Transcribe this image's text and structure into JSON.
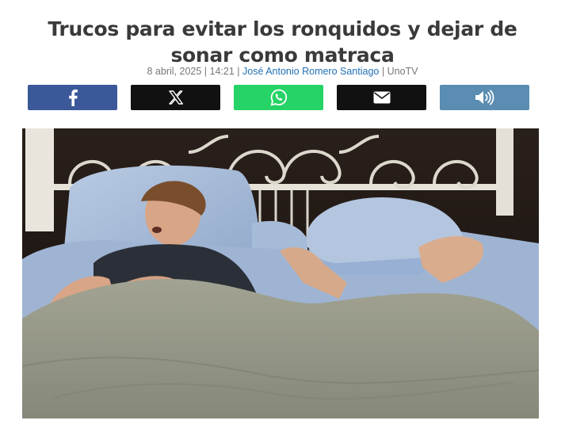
{
  "article": {
    "title": "Trucos para evitar los ronquidos y dejar de sonar como matraca",
    "date": "8 abril, 2025",
    "time": "14:21",
    "author": "José Antonio Romero Santiago",
    "source": "UnoTV",
    "separator": "|"
  },
  "share_buttons": [
    {
      "name": "facebook",
      "icon": "facebook-icon",
      "color": "#3b5998"
    },
    {
      "name": "x",
      "icon": "x-icon",
      "color": "#111111"
    },
    {
      "name": "whatsapp",
      "icon": "whatsapp-icon",
      "color": "#25d366"
    },
    {
      "name": "email",
      "icon": "envelope-icon",
      "color": "#111111"
    },
    {
      "name": "audio",
      "icon": "speaker-icon",
      "color": "#5a8db1"
    }
  ],
  "image": {
    "subject": "couple-in-bed-snoring-photo"
  },
  "colors": {
    "title": "#3a3a3a",
    "author_link": "#1f6fb2"
  }
}
